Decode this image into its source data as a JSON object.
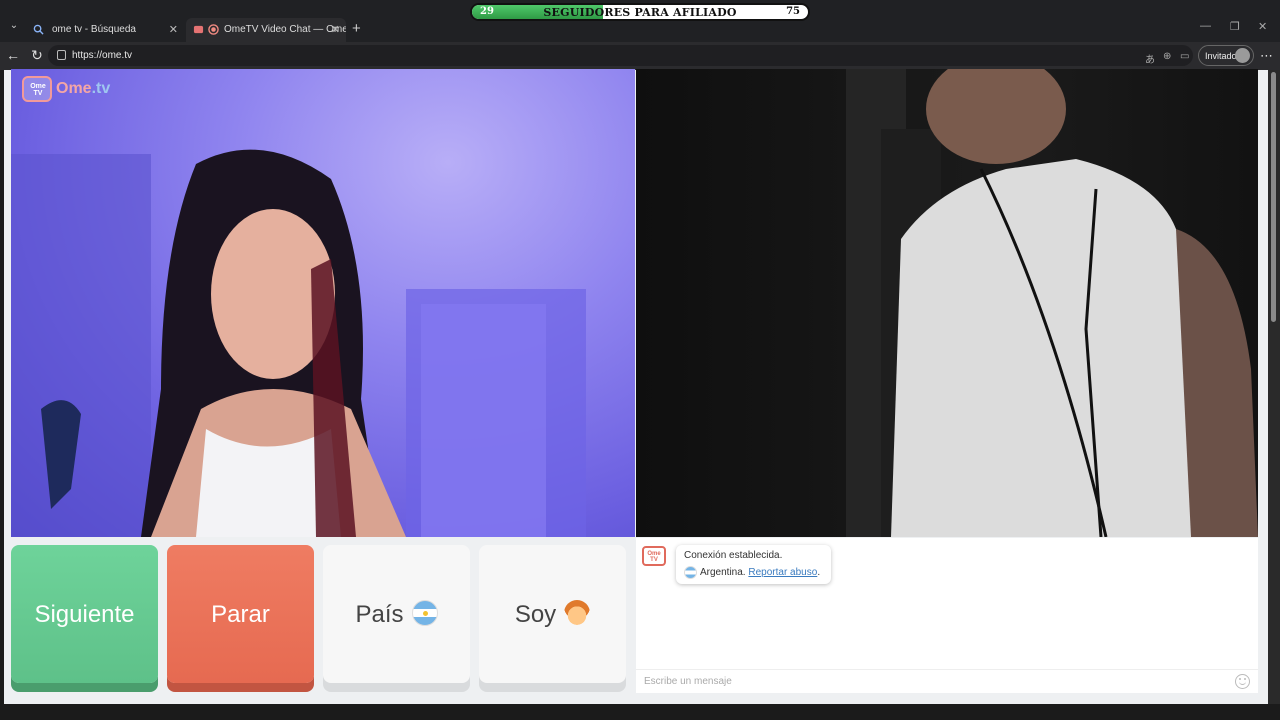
{
  "overlay": {
    "left_number": "29",
    "text": "SEGUIDORES PARA AFILIADO",
    "right_number": "75",
    "progress": 0.39
  },
  "tabs": [
    {
      "title": "ome tv - Búsqueda",
      "icon": "search-icon"
    },
    {
      "title": "OmeTV Video Chat — Omegle",
      "icon": "record-icon",
      "active": true
    }
  ],
  "address": {
    "url": "https://ome.tv",
    "profile_label": "Invitado"
  },
  "logo": {
    "badge": "Ome TV",
    "brand": "Ome",
    "tld": ".tv"
  },
  "buttons": {
    "next": "Siguiente",
    "stop": "Parar",
    "country": "País",
    "gender": "Soy"
  },
  "chat": {
    "system_badge": "Ome TV",
    "message_line1": "Conexión establecida.",
    "country": "Argentina.",
    "report_link": "Reportar abuso",
    "report_suffix": ".",
    "input_placeholder": "Escribe un mensaje"
  },
  "colors": {
    "next": "#5ec189",
    "stop": "#e66a51",
    "accent_link": "#3a7bbf"
  }
}
